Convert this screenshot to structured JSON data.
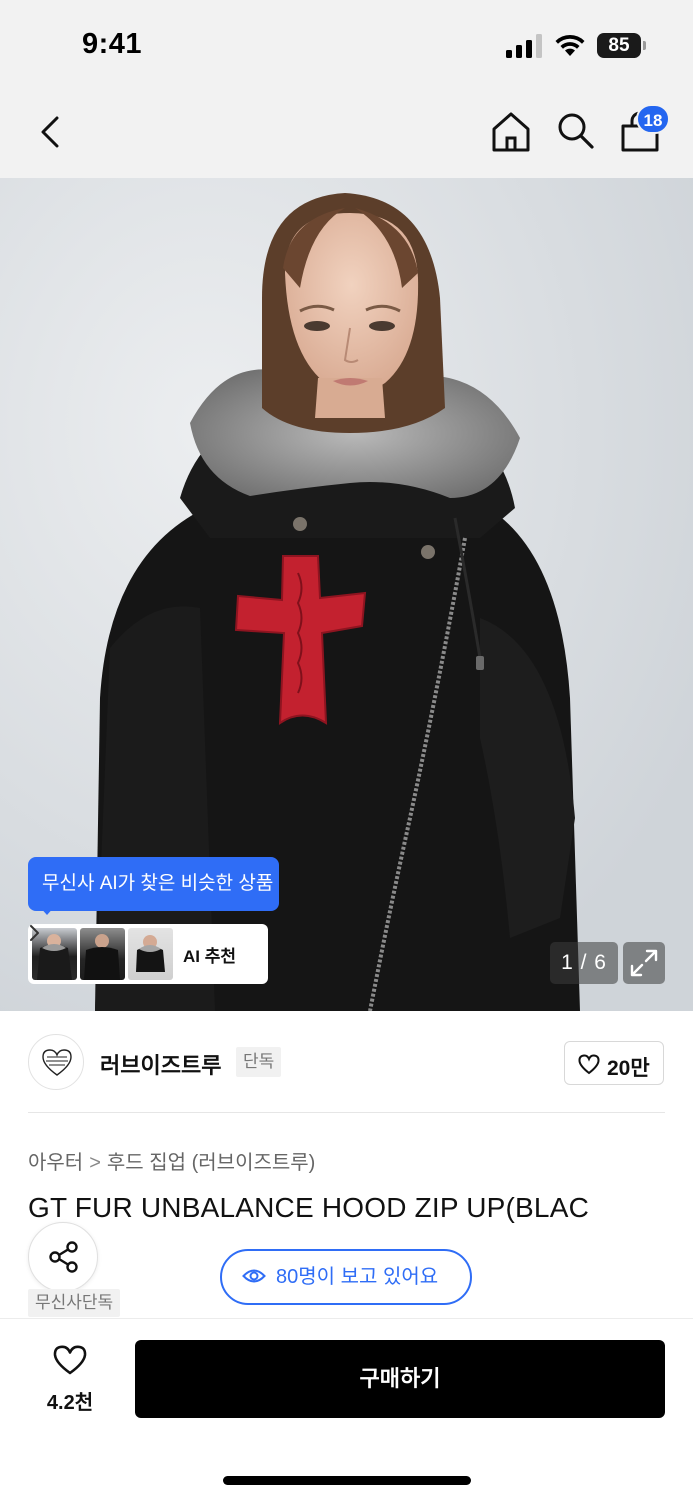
{
  "status_bar": {
    "time": "9:41",
    "battery": "85",
    "icons": [
      "cellular-signal-icon",
      "wifi-icon",
      "battery-icon"
    ]
  },
  "nav": {
    "icons": [
      "back-chevron-icon",
      "home-icon",
      "search-icon",
      "shopping-bag-icon"
    ],
    "cart_count": "18",
    "accent_color": "#2466f0"
  },
  "hero": {
    "ai_tooltip": "무신사 AI가 찾은 비슷한 상품",
    "ai_recommend_label": "AI 추천",
    "page_counter": "1 / 6",
    "expand_icon": "expand-icon"
  },
  "brand": {
    "name": "러브이즈트루",
    "tag": "단독",
    "like_count": "20만"
  },
  "product": {
    "breadcrumb": [
      "아우터",
      "후드 집업 (러브이즈트루)"
    ],
    "title": "GT FUR UNBALANCE HOOD ZIP UP(BLAC",
    "badge": "무신사단독",
    "viewers_text": "80명이 보고 있어요"
  },
  "bottom_bar": {
    "wish_count": "4.2천",
    "buy_label": "구매하기"
  }
}
